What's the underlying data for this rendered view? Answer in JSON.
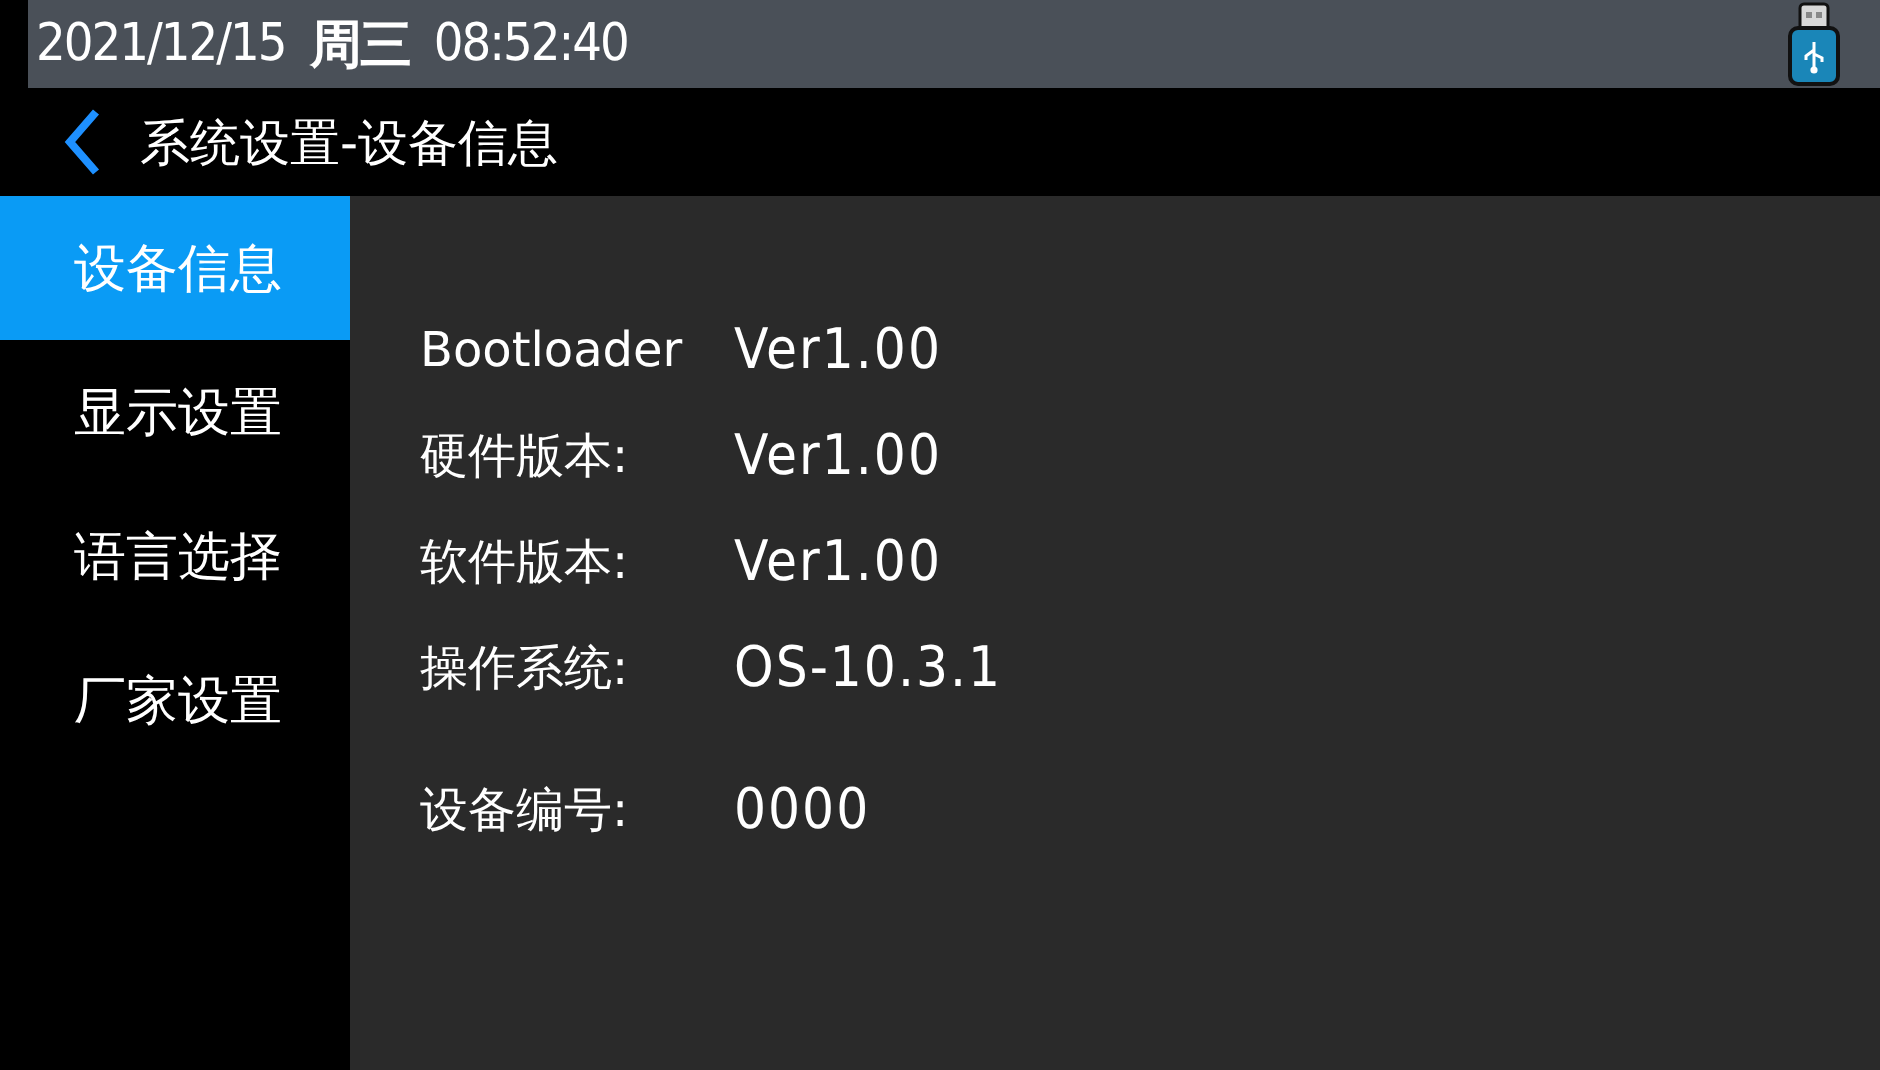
{
  "status_bar": {
    "date": "2021/12/15",
    "weekday": "周三",
    "time": "08:52:40"
  },
  "header": {
    "title": "系统设置-设备信息"
  },
  "sidebar": {
    "items": [
      {
        "label": "设备信息",
        "selected": true
      },
      {
        "label": "显示设置",
        "selected": false
      },
      {
        "label": "语言选择",
        "selected": false
      },
      {
        "label": "厂家设置",
        "selected": false
      }
    ]
  },
  "info_rows": [
    {
      "label": "Bootloader",
      "value": "Ver1.00"
    },
    {
      "label": "硬件版本:",
      "value": "Ver1.00"
    },
    {
      "label": "软件版本:",
      "value": "Ver1.00"
    },
    {
      "label": "操作系统:",
      "value": "OS-10.3.1"
    }
  ],
  "device_number": {
    "label": "设备编号:",
    "value": "0000"
  }
}
